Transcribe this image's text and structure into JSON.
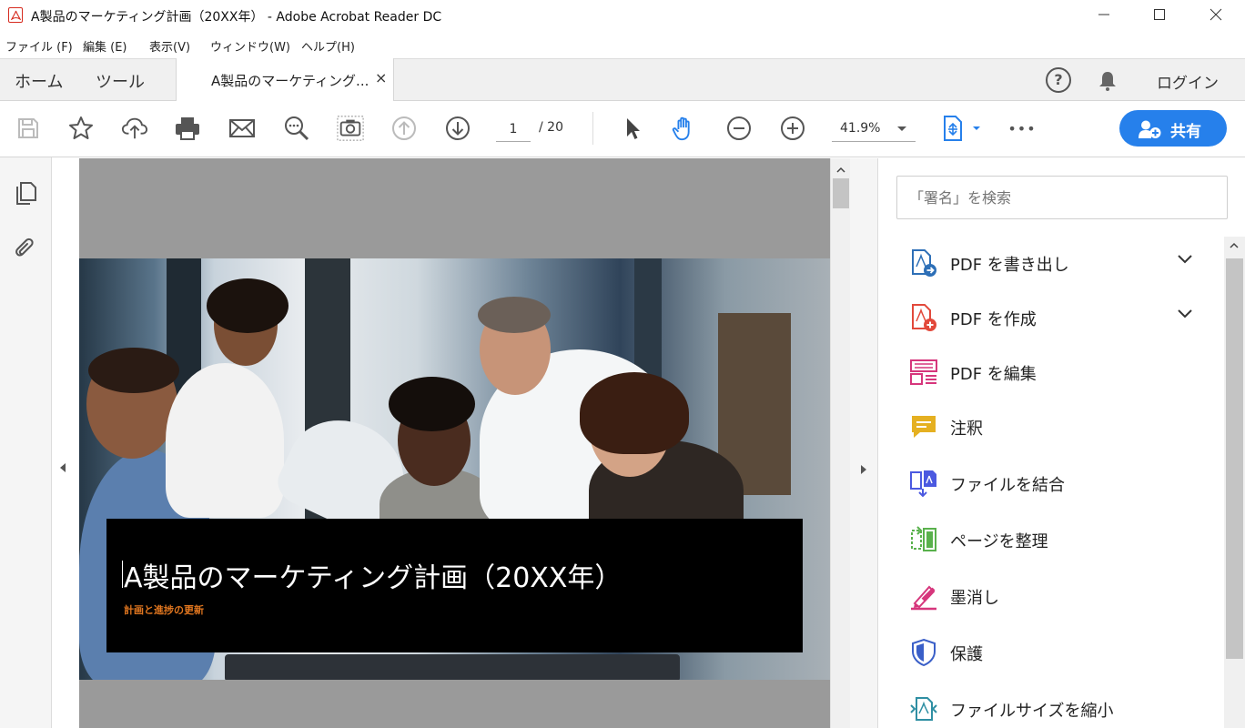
{
  "window": {
    "title": "A製品のマーケティング計画（20XX年） - Adobe Acrobat Reader DC",
    "controls": [
      "minimize",
      "maximize",
      "close"
    ]
  },
  "menubar": {
    "items": [
      "ファイル (F)",
      "編集 (E)",
      "表示(V)",
      "ウィンドウ(W)",
      "ヘルプ(H)"
    ]
  },
  "tabbar": {
    "home": "ホーム",
    "tools": "ツール",
    "document_tab": "A製品のマーケティング...",
    "close_symbol": "×",
    "help_symbol": "?",
    "login": "ログイン"
  },
  "toolbar": {
    "current_page": "1",
    "page_total": "/ 20",
    "zoom": "41.9%",
    "more": "•••",
    "share_label": "共有"
  },
  "document": {
    "title": "A製品のマーケティング計画（20XX年）",
    "subtitle": "計画と進捗の更新"
  },
  "rightpanel": {
    "search_placeholder": "「署名」を検索",
    "tools": [
      {
        "label": "PDF を書き出し",
        "icon": "export-pdf-icon",
        "expandable": true,
        "color": "#2d6fb7"
      },
      {
        "label": "PDF を作成",
        "icon": "create-pdf-icon",
        "expandable": true,
        "color": "#e2493b"
      },
      {
        "label": "PDF を編集",
        "icon": "edit-pdf-icon",
        "expandable": false,
        "color": "#d6367c"
      },
      {
        "label": "注釈",
        "icon": "comment-icon",
        "expandable": false,
        "color": "#e5b021"
      },
      {
        "label": "ファイルを結合",
        "icon": "combine-files-icon",
        "expandable": false,
        "color": "#4b59e0"
      },
      {
        "label": "ページを整理",
        "icon": "organize-pages-icon",
        "expandable": false,
        "color": "#59b14c"
      },
      {
        "label": "墨消し",
        "icon": "redact-icon",
        "expandable": false,
        "color": "#d6367c"
      },
      {
        "label": "保護",
        "icon": "protect-shield-icon",
        "expandable": false,
        "color": "#3a5fc8"
      },
      {
        "label": "ファイルサイズを縮小",
        "icon": "compress-pdf-icon",
        "expandable": false,
        "color": "#2f8fa3"
      }
    ]
  },
  "colors": {
    "accent": "#2680eb",
    "subtitle_orange": "#e0761f",
    "viewer_gray": "#9a9a9a"
  }
}
